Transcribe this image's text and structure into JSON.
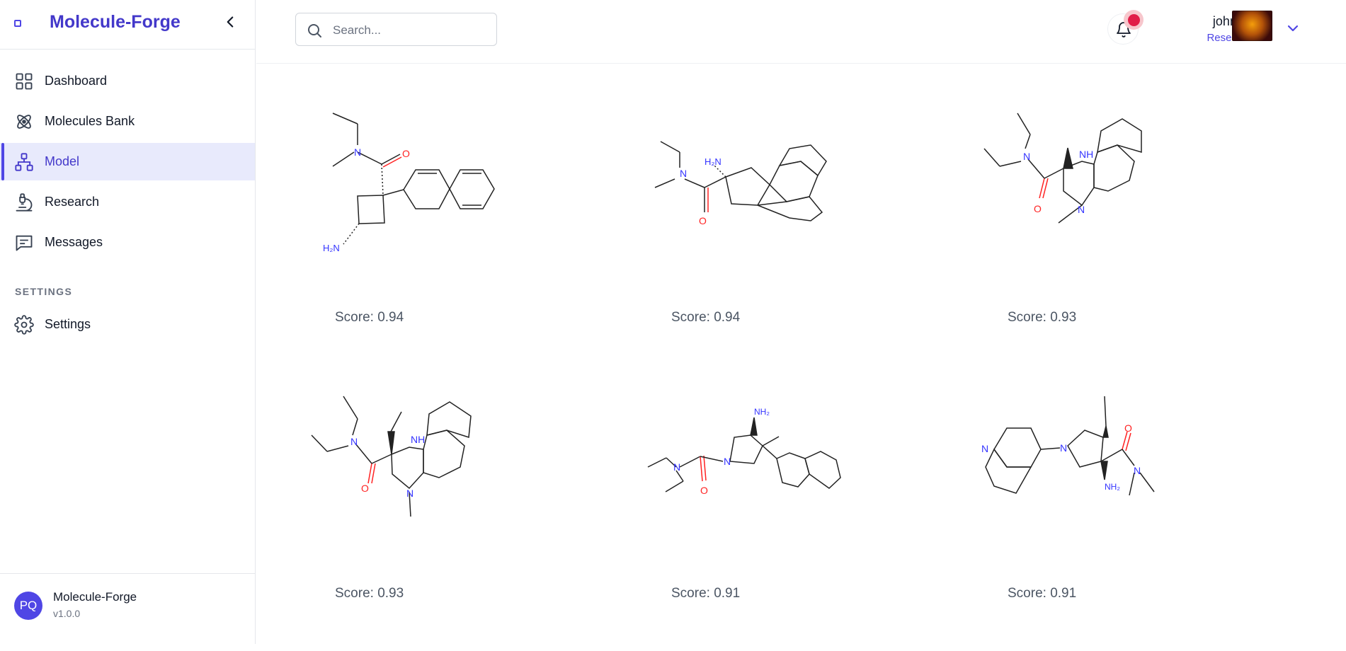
{
  "app": {
    "brand": "Molecule-Forge"
  },
  "sidebar": {
    "items": [
      {
        "label": "Dashboard"
      },
      {
        "label": "Molecules Bank"
      },
      {
        "label": "Model"
      },
      {
        "label": "Research"
      },
      {
        "label": "Messages"
      }
    ],
    "section_label": "SETTINGS",
    "settings_label": "Settings",
    "footer": {
      "initials": "PQ",
      "name": "Molecule-Forge",
      "version": "v1.0.0"
    }
  },
  "header": {
    "search_placeholder": "Search...",
    "user": {
      "name": "john doe",
      "role": "Researcher"
    }
  },
  "results": [
    {
      "score": "Score: 0.94"
    },
    {
      "score": "Score: 0.94"
    },
    {
      "score": "Score: 0.93"
    },
    {
      "score": "Score: 0.93"
    },
    {
      "score": "Score: 0.91"
    },
    {
      "score": "Score: 0.91"
    }
  ],
  "colors": {
    "accent": "#4f46e5",
    "nitrogen": "#3333ff",
    "oxygen": "#ff2a2a",
    "notification": "#e11d48"
  }
}
